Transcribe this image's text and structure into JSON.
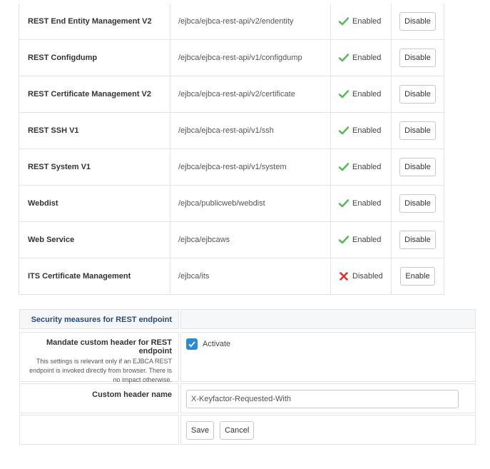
{
  "services": [
    {
      "name": "REST End Entity Management V2",
      "path": "/ejbca/ejbca-rest-api/v2/endentity",
      "status": "Enabled",
      "enabled": true,
      "action": "Disable"
    },
    {
      "name": "REST Configdump",
      "path": "/ejbca/ejbca-rest-api/v1/configdump",
      "status": "Enabled",
      "enabled": true,
      "action": "Disable"
    },
    {
      "name": "REST Certificate Management V2",
      "path": "/ejbca/ejbca-rest-api/v2/certificate",
      "status": "Enabled",
      "enabled": true,
      "action": "Disable"
    },
    {
      "name": "REST SSH V1",
      "path": "/ejbca/ejbca-rest-api/v1/ssh",
      "status": "Enabled",
      "enabled": true,
      "action": "Disable"
    },
    {
      "name": "REST System V1",
      "path": "/ejbca/ejbca-rest-api/v1/system",
      "status": "Enabled",
      "enabled": true,
      "action": "Disable"
    },
    {
      "name": "Webdist",
      "path": "/ejbca/publicweb/webdist",
      "status": "Enabled",
      "enabled": true,
      "action": "Disable"
    },
    {
      "name": "Web Service",
      "path": "/ejbca/ejbcaws",
      "status": "Enabled",
      "enabled": true,
      "action": "Disable"
    },
    {
      "name": "ITS Certificate Management",
      "path": "/ejbca/its",
      "status": "Disabled",
      "enabled": false,
      "action": "Enable"
    }
  ],
  "security": {
    "heading": "Security measures for REST endpoint",
    "mandate_label": "Mandate custom header for REST endpoint",
    "mandate_desc": "This settings is relevant only if an EJBCA REST endpoint is invoked directly from browser. There is no impact otherwise.",
    "activate_label": "Activate",
    "activate_checked": true,
    "header_name_label": "Custom header name",
    "header_name_value": "X-Keyfactor-Requested-With"
  },
  "buttons": {
    "save": "Save",
    "cancel": "Cancel"
  },
  "colors": {
    "check": "#5cb85c",
    "cross": "#d9342b",
    "checkbox": "#2d8bd6",
    "heading": "#2a4a7a"
  },
  "icons": {
    "enabled": "check-icon",
    "disabled": "cross-icon"
  }
}
